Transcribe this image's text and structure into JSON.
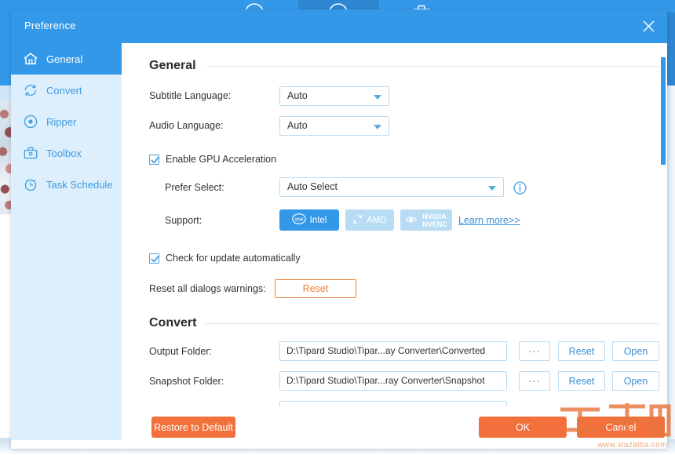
{
  "background": {
    "top_icons": [
      "convert-icon",
      "ripper-icon",
      "toolbox-icon"
    ]
  },
  "dialog": {
    "title": "Preference",
    "close_icon": "close-icon"
  },
  "sidebar": {
    "items": [
      {
        "label": "General",
        "icon": "home-icon",
        "active": true
      },
      {
        "label": "Convert",
        "icon": "refresh-icon",
        "active": false
      },
      {
        "label": "Ripper",
        "icon": "disc-icon",
        "active": false
      },
      {
        "label": "Toolbox",
        "icon": "toolbox-icon",
        "active": false
      },
      {
        "label": "Task Schedule",
        "icon": "clock-icon",
        "active": false
      }
    ]
  },
  "general": {
    "section_title": "General",
    "subtitle_language": {
      "label": "Subtitle Language:",
      "value": "Auto"
    },
    "audio_language": {
      "label": "Audio Language:",
      "value": "Auto"
    },
    "enable_gpu": {
      "label": "Enable GPU Acceleration",
      "checked": true
    },
    "prefer_select": {
      "label": "Prefer Select:",
      "value": "Auto Select",
      "info_icon": "info-icon"
    },
    "support": {
      "label": "Support:",
      "options": [
        {
          "label": "Intel",
          "icon": "intel-logo-icon",
          "enabled": true
        },
        {
          "label": "AMD",
          "icon": "amd-logo-icon",
          "enabled": false
        },
        {
          "label": "NVIDIA\nNVENC",
          "icon": "nvidia-logo-icon",
          "enabled": false
        }
      ],
      "learn_more": "Learn more>>"
    },
    "check_update": {
      "label": "Check for update automatically",
      "checked": true
    },
    "reset_dialogs": {
      "label": "Reset all dialogs warnings:",
      "button": "Reset"
    }
  },
  "convert": {
    "section_title": "Convert",
    "rows": [
      {
        "label": "Output Folder:",
        "path": "D:\\Tipard Studio\\Tipar...ay Converter\\Converted",
        "browse": "···",
        "reset": "Reset",
        "open": "Open"
      },
      {
        "label": "Snapshot Folder:",
        "path": "D:\\Tipard Studio\\Tipar...ray Converter\\Snapshot",
        "browse": "···",
        "reset": "Reset",
        "open": "Open"
      }
    ]
  },
  "footer": {
    "restore": "Restore to Default",
    "ok": "OK",
    "cancel": "Cancel"
  },
  "watermark": {
    "logo_text": "下载吧",
    "url": "www.xiazaiba.com"
  },
  "colors": {
    "accent_blue": "#3498e8",
    "sidebar_bg": "#ddeffc",
    "orange": "#f2703c",
    "orange_outline": "#e8833a",
    "link_blue": "#3a8fd4",
    "border_blue": "#bcdcf2"
  }
}
